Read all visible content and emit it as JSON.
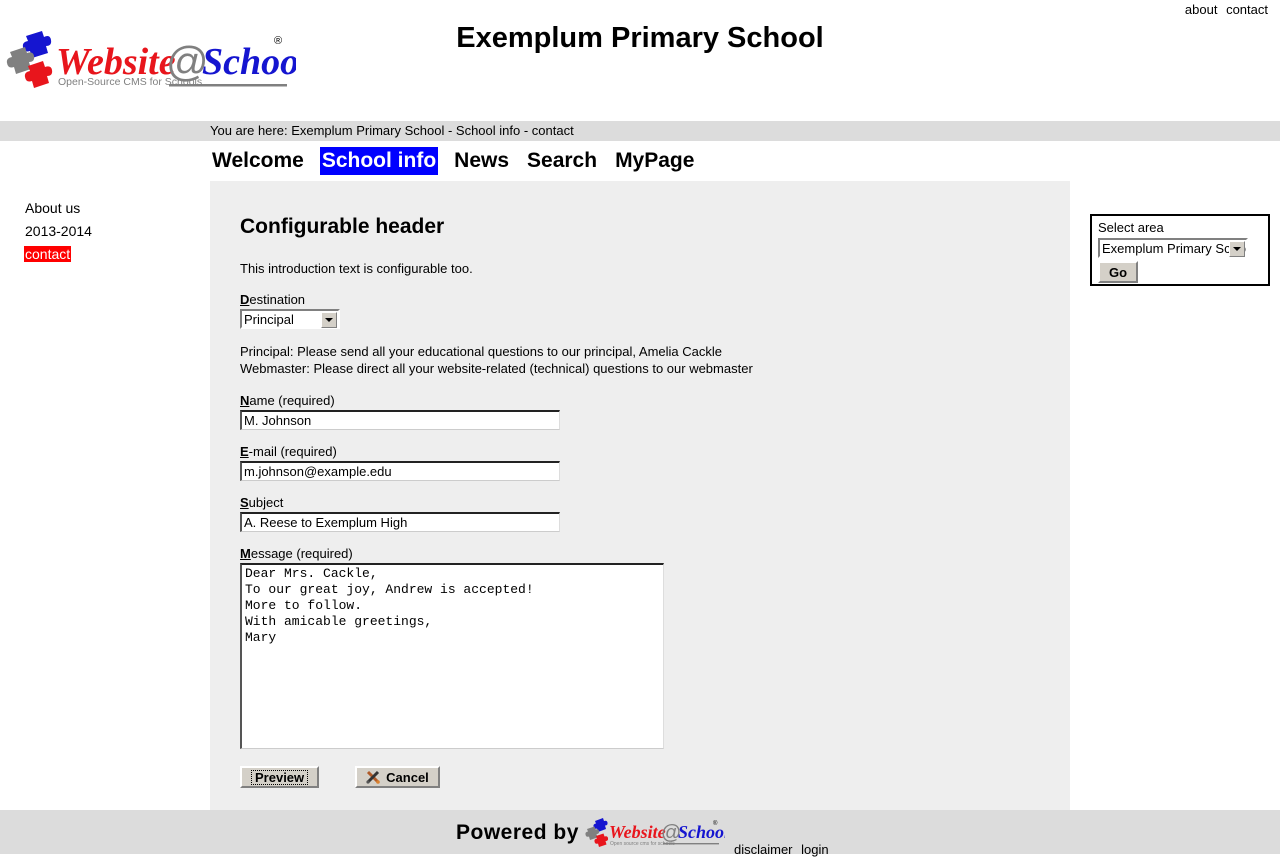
{
  "header": {
    "top_links": [
      "about",
      "contact"
    ],
    "site_title": "Exemplum Primary School",
    "logo_text": "Website@School",
    "logo_tagline": "Open-Source CMS for Schools",
    "logo_registered": "®"
  },
  "breadcrumb": {
    "text": "You are here: Exemplum Primary School - School info - contact"
  },
  "mainmenu": {
    "items": [
      {
        "label": "Welcome",
        "selected": false
      },
      {
        "label": "School info",
        "selected": true
      },
      {
        "label": "News",
        "selected": false
      },
      {
        "label": "Search",
        "selected": false
      },
      {
        "label": "MyPage",
        "selected": false
      }
    ]
  },
  "sidebar": {
    "items": [
      {
        "label": "About us",
        "selected": false
      },
      {
        "label": "2013-2014",
        "selected": false
      },
      {
        "label": "contact",
        "selected": true
      }
    ]
  },
  "content": {
    "page_title": "Configurable header",
    "intro": "This introduction text is configurable too.",
    "destination": {
      "label_accesskey": "D",
      "label_rest": "estination",
      "value": "Principal",
      "options": [
        "Principal",
        "Webmaster"
      ]
    },
    "destination_info": [
      "Principal: Please send all your educational questions to our principal, Amelia Cackle",
      "Webmaster: Please direct all your website-related (technical) questions to our webmaster"
    ],
    "name_field": {
      "label_accesskey": "N",
      "label_rest": "ame (required)",
      "value": "M. Johnson",
      "placeholder": ""
    },
    "email_field": {
      "label_accesskey": "E",
      "label_rest": "-mail (required)",
      "value": "m.johnson@example.edu",
      "placeholder": ""
    },
    "subject_field": {
      "label_accesskey": "S",
      "label_rest": "ubject",
      "value": "A. Reese to Exemplum High",
      "placeholder": ""
    },
    "message_field": {
      "label_accesskey": "M",
      "label_rest": "essage (required)",
      "value": "Dear Mrs. Cackle,\nTo our great joy, Andrew is accepted!\nMore to follow.\nWith amicable greetings,\nMary",
      "placeholder": ""
    },
    "buttons": {
      "preview": "Preview",
      "cancel": "Cancel",
      "cancel_icon": "cross-tools-icon"
    }
  },
  "rightbox": {
    "label": "Select area",
    "selected_area": "Exemplum Primary School",
    "options": [
      "Exemplum Primary School"
    ],
    "go_label": "Go"
  },
  "footer": {
    "powered_by": "Powered by",
    "logo_text": "Website@School",
    "logo_tagline": "Open source cms for schools",
    "links": [
      "disclaimer",
      "login"
    ]
  },
  "colors": {
    "menu_selected_bg": "#0000ff",
    "menu_selected_fg": "#ffffff",
    "sidebar_selected_bg": "#ff0000",
    "sidebar_selected_fg": "#ffffff",
    "bar_gray": "#dcdcdc",
    "content_gray": "#eeeeee",
    "logo_red": "#e8151c",
    "logo_blue": "#1515d0",
    "logo_gray": "#808080"
  }
}
